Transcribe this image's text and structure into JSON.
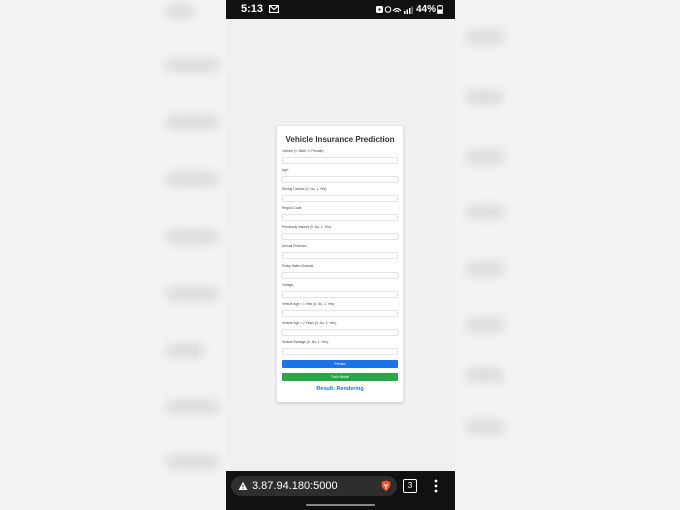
{
  "statusbar": {
    "time": "5:13",
    "battery": "44%"
  },
  "form": {
    "title": "Vehicle Insurance Prediction",
    "fields": [
      {
        "label": "Gender (1: Male, 0: Female):"
      },
      {
        "label": "Age:"
      },
      {
        "label": "Driving License (0: No, 1: Yes):"
      },
      {
        "label": "Region Code:"
      },
      {
        "label": "Previously Insured (0: No, 1: Yes):"
      },
      {
        "label": "Annual Premium:"
      },
      {
        "label": "Policy Sales Channel:"
      },
      {
        "label": "Vintage:"
      },
      {
        "label": "Vehicle Age < 1 Year (0: No, 1: Yes):"
      },
      {
        "label": "Vehicle Age > 2 Years (0: No, 1: Yes):"
      },
      {
        "label": "Vehicle Damage (0: No, 1: Yes):"
      }
    ],
    "predict_label": "Predict",
    "train_label": "Train Model",
    "result_text": "Result: Rendering"
  },
  "browser": {
    "url": "3.87.94.180:5000",
    "tab_count": "3"
  },
  "icons": {
    "mail": "gmail-icon",
    "status": "status-icons",
    "battery": "battery-icon",
    "warning": "warning-icon",
    "brave": "brave-shield-icon",
    "menu": "more-vert-icon"
  },
  "colors": {
    "predict": "#1a73e8",
    "train": "#28a745",
    "result": "#1f6fd0"
  }
}
